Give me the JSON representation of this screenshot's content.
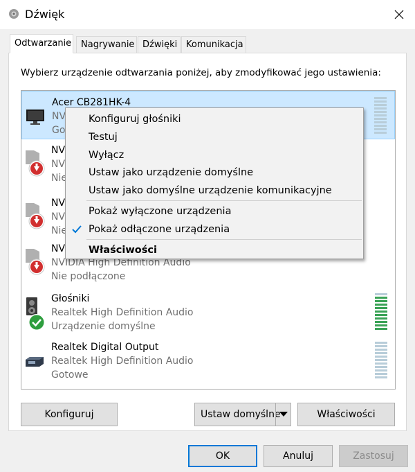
{
  "window": {
    "title": "Dźwięk",
    "app_icon": "speaker-icon",
    "close_icon": "close-icon"
  },
  "tabs": [
    {
      "label": "Odtwarzanie",
      "active": true
    },
    {
      "label": "Nagrywanie",
      "active": false
    },
    {
      "label": "Dźwięki",
      "active": false
    },
    {
      "label": "Komunikacja",
      "active": false
    }
  ],
  "instruction": "Wybierz urządzenie odtwarzania poniżej, aby zmodyfikować jego ustawienia:",
  "devices": [
    {
      "name": "Acer CB281HK-4",
      "driver": "NV",
      "status": "Gotowe",
      "icon": "monitor-icon",
      "selected": true
    },
    {
      "name": "NV",
      "driver": "NV",
      "status": "Nie",
      "icon": "speaker-disconnected-icon"
    },
    {
      "name": "NV",
      "driver": "NV",
      "status": "Nie",
      "icon": "speaker-disconnected-icon"
    },
    {
      "name": "NV",
      "driver": "NVIDIA High Definition Audio",
      "status": "Nie podłączone",
      "icon": "speaker-disconnected-icon"
    },
    {
      "name": "Głośniki",
      "driver": "Realtek High Definition Audio",
      "status": "Urządzenie domyślne",
      "icon": "speaker-default-icon"
    },
    {
      "name": "Realtek Digital Output",
      "driver": "Realtek High Definition Audio",
      "status": "Gotowe",
      "icon": "digital-output-icon"
    }
  ],
  "context_menu": {
    "items": [
      {
        "label": "Konfiguruj głośniki"
      },
      {
        "label": "Testuj"
      },
      {
        "label": "Wyłącz"
      },
      {
        "label": "Ustaw jako urządzenie domyślne"
      },
      {
        "label": "Ustaw jako domyślne urządzenie komunikacyjne"
      },
      {
        "label": "Pokaż wyłączone urządzenia"
      },
      {
        "label": "Pokaż odłączone urządzenia",
        "checked": true
      },
      {
        "label": "Właściwości",
        "bold": true
      }
    ]
  },
  "buttons": {
    "configure": "Konfiguruj",
    "set_default": "Ustaw domyślne",
    "properties": "Właściwości",
    "ok": "OK",
    "cancel": "Anuluj",
    "apply": "Zastosuj"
  },
  "colors": {
    "selection_bg": "#cce8ff",
    "accent": "#0078d7",
    "default_check": "#2e9e3e",
    "disconnected_arrow": "#d12f2f"
  }
}
